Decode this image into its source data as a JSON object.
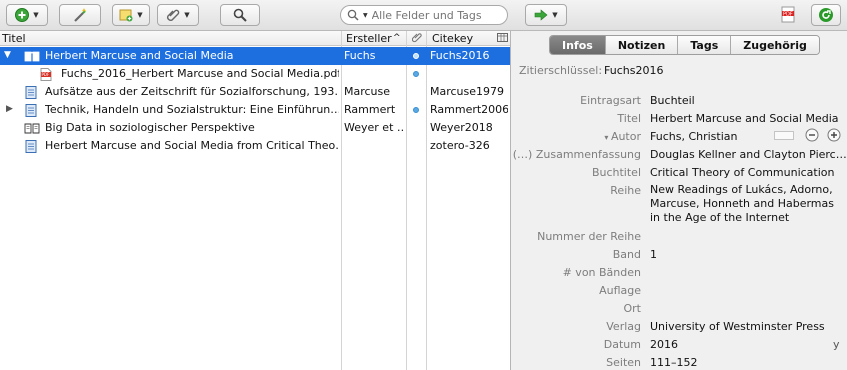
{
  "toolbar": {
    "search_placeholder": "Alle Felder und Tags",
    "search_value": ""
  },
  "columns": {
    "title": "Titel",
    "creator": "Ersteller",
    "citekey": "Citekey"
  },
  "items": [
    {
      "title": "Herbert Marcuse and Social Media",
      "creator": "Fuchs",
      "citekey": "Fuchs2016",
      "icon": "book-icon",
      "selected": true,
      "expanded": true,
      "has_attachment": true
    },
    {
      "title": "Fuchs_2016_Herbert Marcuse and Social Media.pdf",
      "creator": "",
      "citekey": "",
      "icon": "pdf-icon",
      "child": true,
      "has_attachment": true
    },
    {
      "title": "Aufsätze aus der Zeitschrift für Sozialforschung, 193…",
      "creator": "Marcuse",
      "citekey": "Marcuse1979",
      "icon": "document-icon"
    },
    {
      "title": "Technik, Handeln und Sozialstruktur: Eine Einführun…",
      "creator": "Rammert",
      "citekey": "Rammert2006",
      "icon": "document-icon",
      "collapsed": true,
      "has_attachment": true
    },
    {
      "title": "Big Data in soziologischer Perspektive",
      "creator": "Weyer et …",
      "citekey": "Weyer2018",
      "icon": "book-icon"
    },
    {
      "title": "Herbert Marcuse and Social Media from Critical Theo…",
      "creator": "",
      "citekey": "zotero-326",
      "icon": "document-icon"
    }
  ],
  "tabs": {
    "info": "Infos",
    "notes": "Notizen",
    "tags": "Tags",
    "related": "Zugehörig"
  },
  "info": {
    "citekey_label": "Zitierschlüssel:",
    "citekey_value": "Fuchs2016",
    "fields": {
      "itemtype": {
        "label": "Eintragsart",
        "value": "Buchteil"
      },
      "title": {
        "label": "Titel",
        "value": "Herbert Marcuse and Social Media"
      },
      "author": {
        "label": "Autor",
        "value": "Fuchs, Christian"
      },
      "abstract": {
        "label": "(…) Zusammenfassung",
        "value": "Douglas Kellner and Clayton Pierc…"
      },
      "booktitle": {
        "label": "Buchtitel",
        "value": "Critical Theory of Communication"
      },
      "series": {
        "label": "Reihe",
        "value": "New Readings of Lukács, Adorno, Marcuse, Honneth and Habermas in the Age of the Internet"
      },
      "series_number": {
        "label": "Nummer der Reihe",
        "value": ""
      },
      "volume": {
        "label": "Band",
        "value": "1"
      },
      "num_volumes": {
        "label": "# von Bänden",
        "value": ""
      },
      "edition": {
        "label": "Auflage",
        "value": ""
      },
      "place": {
        "label": "Ort",
        "value": ""
      },
      "publisher": {
        "label": "Verlag",
        "value": "University of Westminster Press"
      },
      "date": {
        "label": "Datum",
        "value": "2016",
        "suffix": "y"
      },
      "pages": {
        "label": "Seiten",
        "value": "111–152"
      }
    }
  },
  "colors": {
    "selection": "#1d6fe0",
    "add_green": "#2f9a2f",
    "sync_green": "#2a9a2a"
  }
}
